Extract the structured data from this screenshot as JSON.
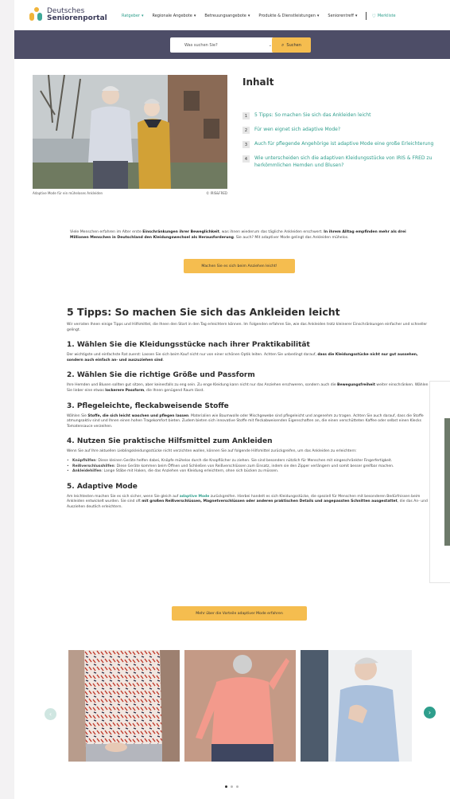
{
  "header": {
    "logo_line1": "Deutsches",
    "logo_line2": "Seniorenportal",
    "nav": [
      {
        "label": "Ratgeber"
      },
      {
        "label": "Regionale Angebote"
      },
      {
        "label": "Betreuungsangebote"
      },
      {
        "label": "Produkte & Dienstleistungen"
      },
      {
        "label": "Seniorentreff"
      }
    ],
    "merkliste": "Merkliste",
    "accent": "#2e9e8c"
  },
  "search": {
    "placeholder": "Was suchen Sie?",
    "button": "Suchen",
    "band_color": "#4d4d67",
    "button_color": "#f5bd4f"
  },
  "hero": {
    "caption": "Adaptive Mode für ein müheloses Ankleiden",
    "credit": "© IRIS&FRED"
  },
  "toc": {
    "title": "Inhalt",
    "items": [
      {
        "num": "1",
        "text": "5 Tipps: So machen Sie sich das Ankleiden leicht"
      },
      {
        "num": "2",
        "text": "Für wen eignet sich adaptive Mode?"
      },
      {
        "num": "3",
        "text": "Auch für pflegende Angehörige ist adaptive Mode eine große Erleichterung"
      },
      {
        "num": "4",
        "text": "Wie unterscheiden sich die adaptiven Kleidungsstücke von IRIS & FRED zu herkömmlichen Hemden und Blusen?"
      }
    ]
  },
  "intro": {
    "t1": "Viele Menschen erfahren im Alter erste ",
    "b1": "Einschränkungen ihrer Beweglichkeit",
    "t2": ", was ihnen wiederum das tägliche Ankleiden erschwert. ",
    "b2": "In ihrem Alltag empfinden mehr als drei Millionen Menschen in Deutschland den Kleidungswechsel als Herausforderung",
    "t3": ". Sie auch? Mit adaptiver Mode gelingt das Ankleiden mühelos.",
    "button": "Machen Sie es sich beim Anziehen leicht!"
  },
  "article": {
    "h2": "5 Tipps: So machen Sie sich das Ankleiden leicht",
    "lead": "Wir verraten Ihnen einige Tipps und Hilfsmittel, die Ihnen den Start in den Tag erleichtern können. Im Folgenden erfahren Sie, wie das Ankleiden trotz kleinerer Einschränkungen einfacher und schneller gelingt.",
    "s1_title": "1. Wählen Sie die Kleidungsstücke nach ihrer Praktikabilität",
    "s1_t": "Der wichtigste und einfachste Rat zuerst: Lassen Sie sich beim Kauf nicht nur von einer schönen Optik leiten. Achten Sie unbedingt darauf, ",
    "s1_b": "dass die Kleidungsstücke nicht nur gut aussehen, sondern auch einfach an- und auszuziehen sind",
    "s1_e": ".",
    "s2_title": "2. Wählen Sie die richtige Größe und Passform",
    "s2_t": "Ihre Hemden und Blusen sollten gut sitzen, aber keinesfalls zu eng sein. Zu enge Kleidung kann nicht nur das Anziehen erschweren, sondern auch die ",
    "s2_b1": "Bewegungsfreiheit",
    "s2_t2": " weiter einschränken. Wählen Sie lieber eine etwas ",
    "s2_b2": "lockerere Passform",
    "s2_e": ", die Ihnen genügend Raum lässt.",
    "s3_title": "3. Pflegeleichte, fleckabweisende Stoffe",
    "s3_t": "Wählen Sie ",
    "s3_b": "Stoffe, die sich leicht waschen und pflegen lassen",
    "s3_e": ". Materialien wie Baumwolle oder Mischgewebe sind pflegeleicht und angenehm zu tragen. Achten Sie auch darauf, dass die Stoffe atmungsaktiv sind und Ihnen einen hohen Tragekomfort bieten. Zudem bieten sich innovative Stoffe mit fleckabweisenden Eigenschaften an, die einen verschütteten Kaffee oder selbst einen Klecks Tomatensauce verzeihen.",
    "s4_title": "4. Nutzen Sie praktische Hilfsmittel zum Ankleiden",
    "s4_t": "Wenn Sie auf Ihre aktuellen Lieblingskleidungsstücke nicht verzichten wollen, können Sie auf folgende Hilfsmittel zurückgreifen, um das Ankleiden zu erleichtern:",
    "s4_list": [
      {
        "b": "Knöpfhilfen",
        "t": ": Diese kleinen Geräte helfen dabei, Knöpfe mühelos durch die Knopflöcher zu ziehen. Sie sind besonders nützlich für Menschen mit eingeschränkter Fingerfertigkeit."
      },
      {
        "b": "Reißverschlusshilfen",
        "t": ": Diese Geräte kommen beim Öffnen und Schließen von Reißverschlüssen zum Einsatz, indem sie den Zipper verlängern und somit besser greifbar machen."
      },
      {
        "b": "Ankleidehilfen",
        "t": ": Lange Stäbe mit Haken, die das Anziehen von Kleidung erleichtern, ohne sich bücken zu müssen."
      }
    ],
    "s5_title": "5. Adaptive Mode",
    "s5_t": "Am leichtesten machen Sie es sich sicher, wenn Sie gleich auf ",
    "s5_link": "adaptive Mode",
    "s5_t2": " zurückgreifen. Hierbei handelt es sich Kleidungsstücke, die speziell für Menschen mit besonderen Bedürfnissen beim Ankleiden entwickelt wurden. Sie sind oft ",
    "s5_b": "mit großen Reißverschlüssen, Magnetverschlüssen oder anderen praktischen Details und angepassten Schnitten ausgestattet",
    "s5_e": ", die das An- und Ausziehen deutlich erleichtern.",
    "button": "Mehr über die Vorteile adaptiver Mode erfahren"
  },
  "carousel": {
    "images": [
      {
        "icon": "patterned-blouse-photo"
      },
      {
        "icon": "pink-blouse-photo"
      },
      {
        "icon": "man-in-shirt-photo"
      }
    ],
    "prev_icon": "arrow-left-icon",
    "next_icon": "arrow-right-icon",
    "dots_count": 3
  }
}
